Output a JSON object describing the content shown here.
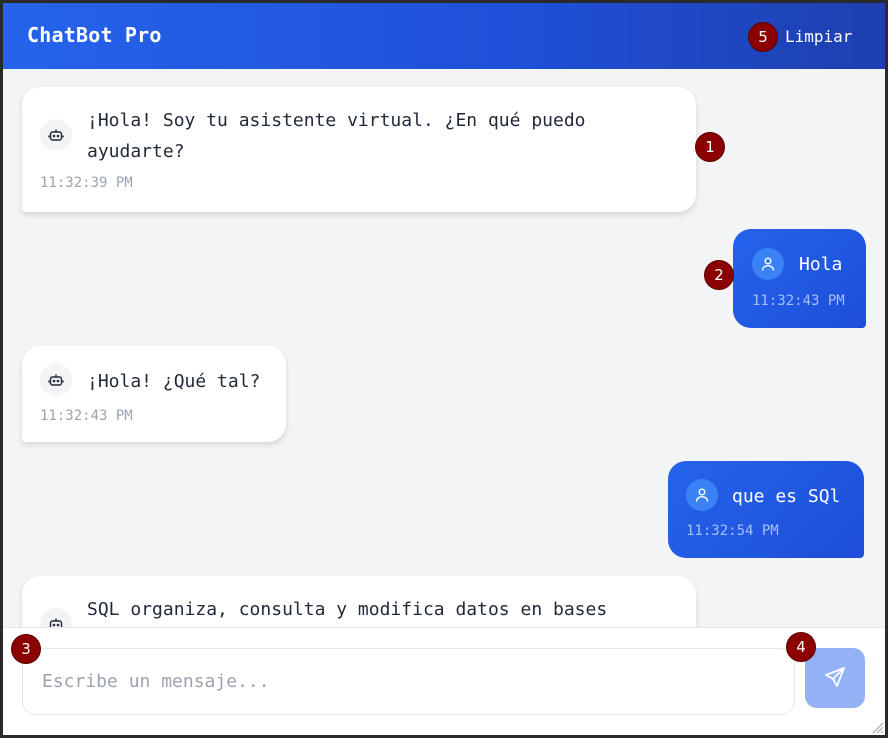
{
  "header": {
    "title": "ChatBot Pro",
    "clear_label": "Limpiar"
  },
  "messages": [
    {
      "role": "bot",
      "lines": [
        "¡Hola! Soy tu asistente virtual. ¿En qué puedo",
        "ayudarte?"
      ],
      "time": "11:32:39 PM"
    },
    {
      "role": "user",
      "text": "Hola",
      "time": "11:32:43 PM"
    },
    {
      "role": "bot",
      "text": "¡Hola! ¿Qué tal?",
      "time": "11:32:43 PM"
    },
    {
      "role": "user",
      "text": "que es SQl",
      "time": "11:32:54 PM"
    },
    {
      "role": "bot",
      "text": "SQL organiza, consulta y modifica datos en bases"
    }
  ],
  "composer": {
    "placeholder": "Escribe un mensaje..."
  },
  "badges": [
    "1",
    "2",
    "3",
    "4",
    "5"
  ],
  "icons": {
    "bot": "robot-icon",
    "user": "user-icon",
    "send": "send-icon"
  },
  "colors": {
    "accent": "#2563eb",
    "badge": "#8b0000"
  }
}
